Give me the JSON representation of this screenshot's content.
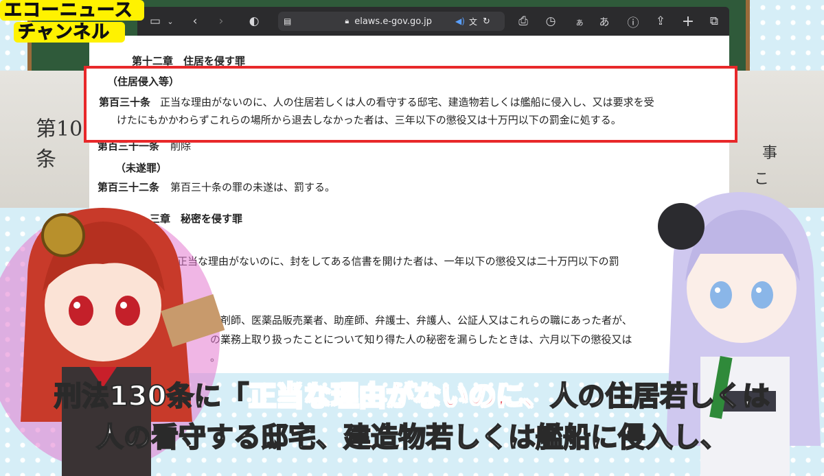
{
  "logo": {
    "line1": "エコーニュース",
    "line2": "チャンネル"
  },
  "browser": {
    "url": "elaws.e-gov.go.jp",
    "font_small": "ぁ",
    "font_large": "あ"
  },
  "document": {
    "chapter12": "第十二章　住居を侵す罪",
    "art130_caption": "（住居侵入等）",
    "art130_num": "第百三十条",
    "art130_line1": "正当な理由がないのに、人の住居若しくは人の看守する邸宅、建造物若しくは艦船に侵入し、又は要求を受",
    "art130_line2": "けたにもかかわらずこれらの場所から退去しなかった者は、三年以下の懲役又は十万円以下の罰金に処する。",
    "art131_num": "第百三十一条",
    "art131_text": "削除",
    "art132_caption": "（未遂罪）",
    "art132_num": "第百三十二条",
    "art132_text": "第百三十条の罪の未遂は、罰する。",
    "chapter13_partial": "三章　秘密を侵す罪",
    "art133_partial": "正当な理由がないのに、封をしてある信書を開けた者は、一年以下の懲役又は二十万円以下の罰",
    "art134_partial1": "薬剤師、医薬品販売業者、助産師、弁護士、弁護人、公証人又はこれらの職にあった者が、",
    "art134_partial2": "の業務上取り扱ったことについて知り得た人の秘密を漏らしたときは、六月以下の懲役又は",
    "art134_partial3": "。"
  },
  "photo": {
    "left_text": "第10条",
    "right_text1": "事",
    "right_text2": "こ"
  },
  "subtitle": {
    "line1_a": "刑法130条に「",
    "line1_b": "正当な理由がないのに、",
    "line1_c": "人の住居若しくは",
    "line2_a": "人の看守する邸宅、",
    "line2_b": "建造物若しくは艦船に侵入し、"
  },
  "colors": {
    "highlight": "#e8282a",
    "subtitle_red": "#e3212e",
    "logo_yellow": "#fff200"
  }
}
